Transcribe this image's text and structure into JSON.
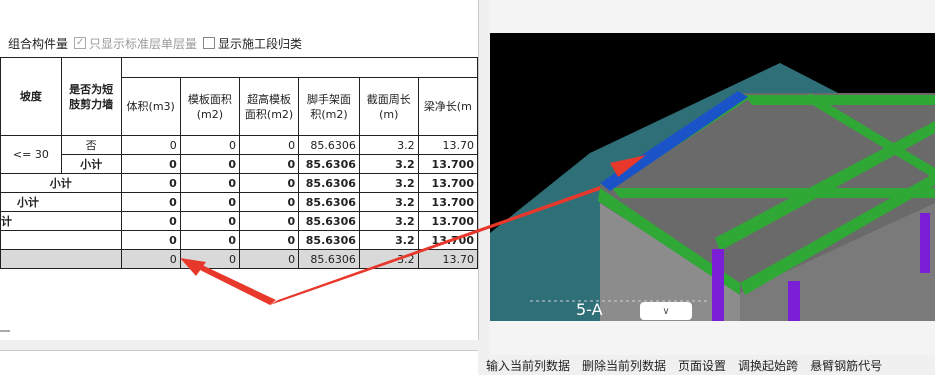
{
  "options": {
    "combo_label": "组合构件量",
    "show_std_floor": {
      "label": "只显示标准层单层量",
      "checked": true
    },
    "show_construction": {
      "label": "显示施工段归类",
      "checked": false
    }
  },
  "table": {
    "headers": {
      "slope": "坡度",
      "shear_wall": "是否为短肢剪力墙",
      "volume": "体积(m3)",
      "formwork_area": "模板面积(m2)",
      "high_formwork": "超高模板面积(m2)",
      "scaffold_area": "脚手架面积(m2)",
      "perimeter": "截面周长(m)",
      "beam_length": "梁净长(m"
    },
    "rows": [
      {
        "slope": "<= 30",
        "wall": "否",
        "volume": "0",
        "formwork": "0",
        "high": "0",
        "scaffold": "85.6306",
        "perimeter": "3.2",
        "length": "13.70"
      },
      {
        "wall": "小计",
        "volume": "0",
        "formwork": "0",
        "high": "0",
        "scaffold": "85.6306",
        "perimeter": "3.2",
        "length": "13.700"
      },
      {
        "label": "小计",
        "volume": "0",
        "formwork": "0",
        "high": "0",
        "scaffold": "85.6306",
        "perimeter": "3.2",
        "length": "13.700"
      },
      {
        "label": "小计",
        "volume": "0",
        "formwork": "0",
        "high": "0",
        "scaffold": "85.6306",
        "perimeter": "3.2",
        "length": "13.700"
      },
      {
        "label": "计",
        "volume": "0",
        "formwork": "0",
        "high": "0",
        "scaffold": "85.6306",
        "perimeter": "3.2",
        "length": "13.700"
      },
      {
        "label": "",
        "volume": "0",
        "formwork": "0",
        "high": "0",
        "scaffold": "85.6306",
        "perimeter": "3.2",
        "length": "13.700"
      },
      {
        "label": "",
        "volume": "0",
        "formwork": "0",
        "high": "0",
        "scaffold": "85.6306",
        "perimeter": "3.2",
        "length": "13.70"
      }
    ]
  },
  "viewport": {
    "axis_label": "5-A",
    "dropdown_glyph": "∨"
  },
  "toolbar": [
    "输入当前列数据",
    "删除当前列数据",
    "页面设置",
    "调换起始跨",
    "悬臂钢筋代号"
  ],
  "colors": {
    "accent_arrow": "#e8382b",
    "beam_green": "#2fa836",
    "beam_blue": "#1a53c8",
    "column_purple": "#7a1fd6",
    "slab_gray": "#666666"
  }
}
